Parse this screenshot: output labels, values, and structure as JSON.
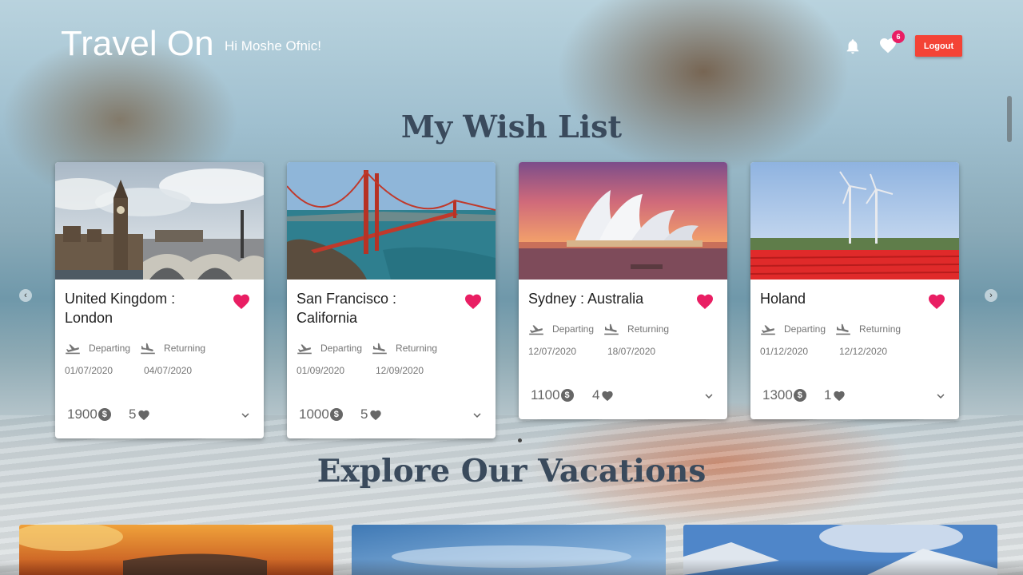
{
  "header": {
    "brand": "Travel On",
    "greeting": "Hi Moshe Ofnic!",
    "notifications_icon": "bell-icon",
    "favorites_icon": "heart-icon",
    "favorites_count": "6",
    "logout_label": "Logout"
  },
  "wish_list": {
    "title": "My Wish List",
    "cards": [
      {
        "title": "United Kingdom : London",
        "departing_label": "Departing",
        "returning_label": "Returning",
        "departing_date": "01/07/2020",
        "returning_date": "04/07/2020",
        "price": "1900",
        "likes": "5"
      },
      {
        "title": "San Francisco : California",
        "departing_label": "Departing",
        "returning_label": "Returning",
        "departing_date": "01/09/2020",
        "returning_date": "12/09/2020",
        "price": "1000",
        "likes": "5"
      },
      {
        "title": "Sydney : Australia",
        "departing_label": "Departing",
        "returning_label": "Returning",
        "departing_date": "12/07/2020",
        "returning_date": "18/07/2020",
        "price": "1100",
        "likes": "4"
      },
      {
        "title": "Holand",
        "departing_label": "Departing",
        "returning_label": "Returning",
        "departing_date": "01/12/2020",
        "returning_date": "12/12/2020",
        "price": "1300",
        "likes": "1"
      }
    ]
  },
  "explore": {
    "title": "Explore Our Vacations"
  },
  "colors": {
    "accent": "#e91e63",
    "logout": "#f44336",
    "heading": "#3a4a5c"
  }
}
